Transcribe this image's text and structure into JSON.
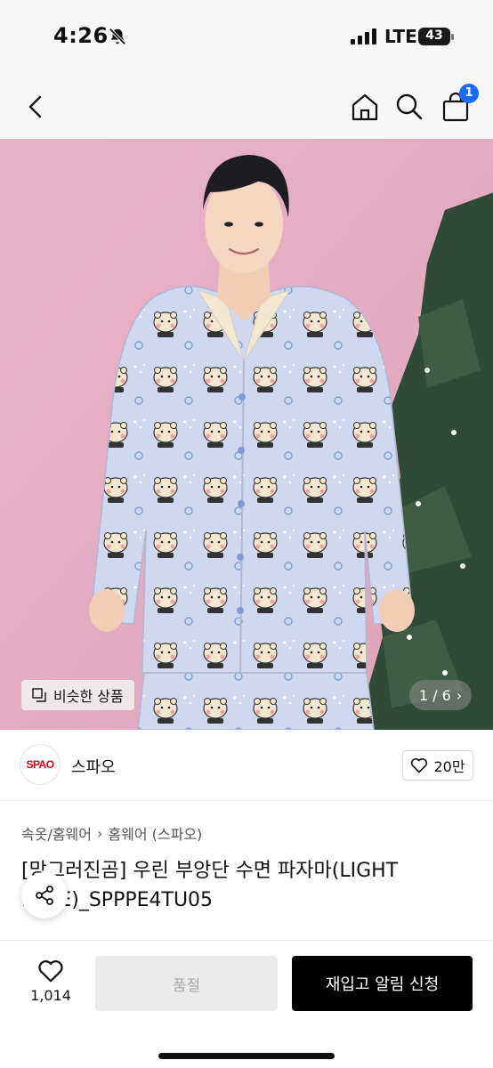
{
  "status_bar": {
    "time": "4:26",
    "network": "LTE",
    "battery": "43"
  },
  "header": {
    "cart_count": "1"
  },
  "gallery": {
    "similar_label": "비슷한 상품",
    "page_indicator": "1 / 6"
  },
  "brand": {
    "logo_text": "SPAO",
    "name": "스파오",
    "likes": "20만"
  },
  "breadcrumb": [
    "속옷/홈웨어",
    "홈웨어 (스파오)"
  ],
  "product": {
    "title": "[망그러진곰] 우린 부앙단 수면 파자마(LIGHT BLUE)_SPPPE4TU05"
  },
  "bottom_bar": {
    "wish_count": "1,014",
    "soldout_label": "품절",
    "restock_label": "재입고 알림 신청"
  },
  "colors": {
    "accent_badge": "#1a6bff",
    "primary_button": "#000000",
    "disabled_button": "#ebebeb"
  }
}
